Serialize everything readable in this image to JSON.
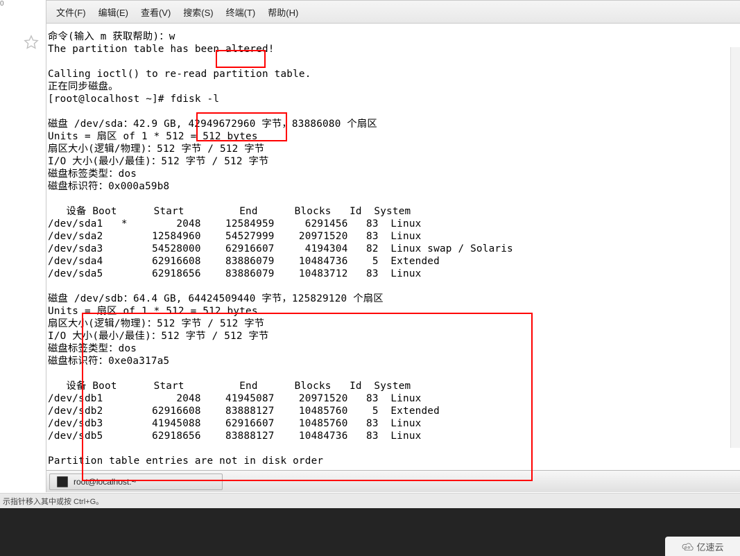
{
  "leftcol": {
    "zero": "0"
  },
  "menu": {
    "file": "文件(F)",
    "edit": "编辑(E)",
    "view": "查看(V)",
    "search": "搜索(S)",
    "terminal": "终端(T)",
    "help": "帮助(H)"
  },
  "terminal": {
    "lines": [
      "命令(输入 m 获取帮助)：w",
      "The partition table has been altered!",
      "",
      "Calling ioctl() to re-read partition table.",
      "正在同步磁盘。",
      "[root@localhost ~]# fdisk -l",
      "",
      "磁盘 /dev/sda：42.9 GB, 42949672960 字节，83886080 个扇区",
      "Units = 扇区 of 1 * 512 = 512 bytes",
      "扇区大小(逻辑/物理)：512 字节 / 512 字节",
      "I/O 大小(最小/最佳)：512 字节 / 512 字节",
      "磁盘标签类型：dos",
      "磁盘标识符：0x000a59b8",
      "",
      "   设备 Boot      Start         End      Blocks   Id  System",
      "/dev/sda1   *        2048    12584959     6291456   83  Linux",
      "/dev/sda2        12584960    54527999    20971520   83  Linux",
      "/dev/sda3        54528000    62916607     4194304   82  Linux swap / Solaris",
      "/dev/sda4        62916608    83886079    10484736    5  Extended",
      "/dev/sda5        62918656    83886079    10483712   83  Linux",
      "",
      "磁盘 /dev/sdb：64.4 GB, 64424509440 字节，125829120 个扇区",
      "Units = 扇区 of 1 * 512 = 512 bytes",
      "扇区大小(逻辑/物理)：512 字节 / 512 字节",
      "I/O 大小(最小/最佳)：512 字节 / 512 字节",
      "磁盘标签类型：dos",
      "磁盘标识符：0xe0a317a5",
      "",
      "   设备 Boot      Start         End      Blocks   Id  System",
      "/dev/sdb1            2048    41945087    20971520   83  Linux",
      "/dev/sdb2        62916608    83888127    10485760    5  Extended",
      "/dev/sdb3        41945088    62916607    10485760   83  Linux",
      "/dev/sdb5        62918656    83888127    10484736   83  Linux",
      "",
      "Partition table entries are not in disk order"
    ],
    "task_title": "root@localhost:~"
  },
  "hint": "示指针移入其中或按 Ctrl+G。",
  "watermark": {
    "text": "亿速云"
  },
  "disks": {
    "sda": {
      "size_gb": "42.9 GB",
      "bytes": "42949672960",
      "sectors": "83886080",
      "units": "扇区 of 1 * 512 = 512 bytes",
      "sector_size": "512 字节 / 512 字节",
      "io_size": "512 字节 / 512 字节",
      "label_type": "dos",
      "identifier": "0x000a59b8",
      "partitions": [
        {
          "device": "/dev/sda1",
          "boot": "*",
          "start": 2048,
          "end": 12584959,
          "blocks": 6291456,
          "id": "83",
          "system": "Linux"
        },
        {
          "device": "/dev/sda2",
          "boot": "",
          "start": 12584960,
          "end": 54527999,
          "blocks": 20971520,
          "id": "83",
          "system": "Linux"
        },
        {
          "device": "/dev/sda3",
          "boot": "",
          "start": 54528000,
          "end": 62916607,
          "blocks": 4194304,
          "id": "82",
          "system": "Linux swap / Solaris"
        },
        {
          "device": "/dev/sda4",
          "boot": "",
          "start": 62916608,
          "end": 83886079,
          "blocks": 10484736,
          "id": "5",
          "system": "Extended"
        },
        {
          "device": "/dev/sda5",
          "boot": "",
          "start": 62918656,
          "end": 83886079,
          "blocks": 10483712,
          "id": "83",
          "system": "Linux"
        }
      ]
    },
    "sdb": {
      "size_gb": "64.4 GB",
      "bytes": "64424509440",
      "sectors": "125829120",
      "units": "扇区 of 1 * 512 = 512 bytes",
      "sector_size": "512 字节 / 512 字节",
      "io_size": "512 字节 / 512 字节",
      "label_type": "dos",
      "identifier": "0xe0a317a5",
      "partitions": [
        {
          "device": "/dev/sdb1",
          "boot": "",
          "start": 2048,
          "end": 41945087,
          "blocks": 20971520,
          "id": "83",
          "system": "Linux"
        },
        {
          "device": "/dev/sdb2",
          "boot": "",
          "start": 62916608,
          "end": 83888127,
          "blocks": 10485760,
          "id": "5",
          "system": "Extended"
        },
        {
          "device": "/dev/sdb3",
          "boot": "",
          "start": 41945088,
          "end": 62916607,
          "blocks": 10485760,
          "id": "83",
          "system": "Linux"
        },
        {
          "device": "/dev/sdb5",
          "boot": "",
          "start": 62918656,
          "end": 83888127,
          "blocks": 10484736,
          "id": "83",
          "system": "Linux"
        }
      ]
    }
  },
  "commands": {
    "fdisk_prompt": "命令(输入 m 获取帮助)：",
    "fdisk_input": "w",
    "shell_command": "fdisk -l"
  }
}
